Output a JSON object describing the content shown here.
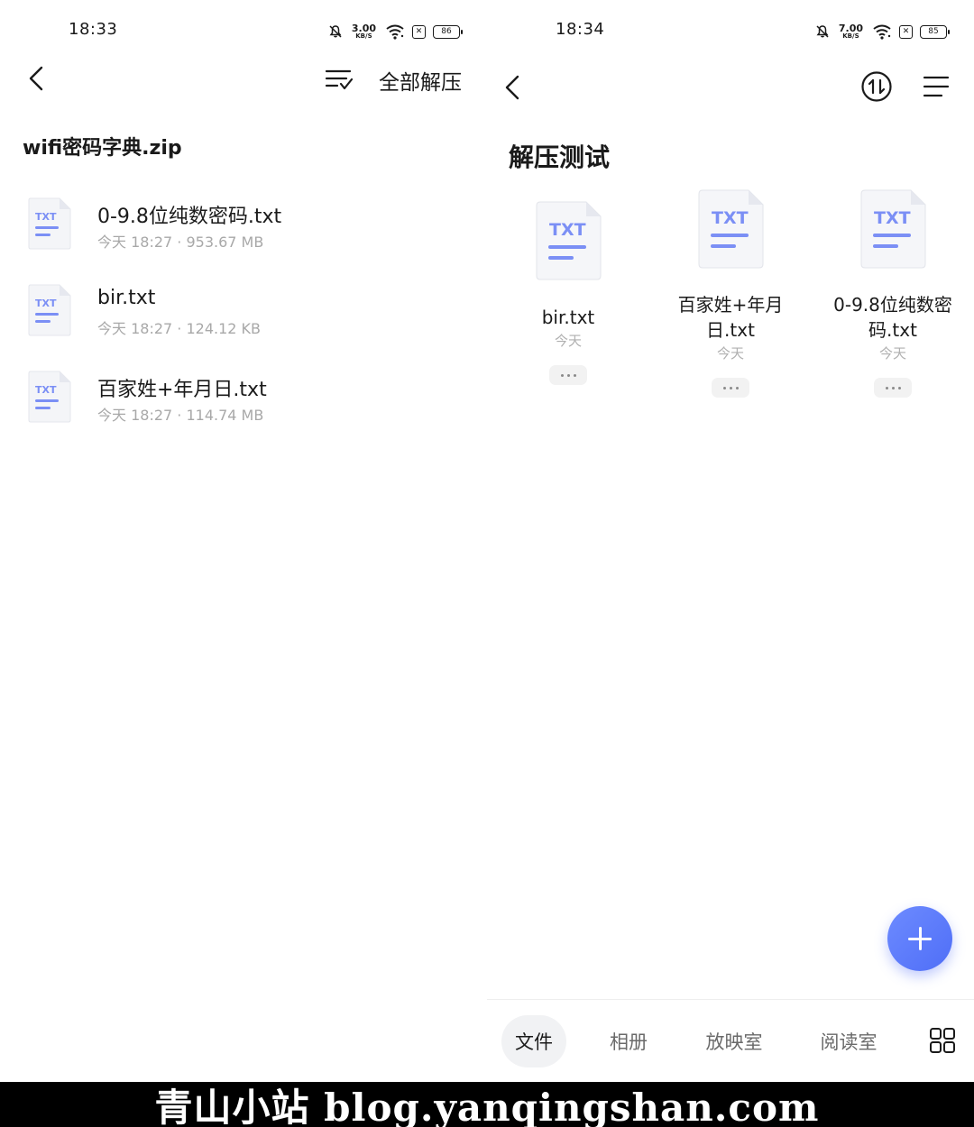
{
  "left": {
    "status": {
      "time": "18:33",
      "speed_value": "3.00",
      "speed_unit": "KB/S",
      "battery": "86"
    },
    "header": {
      "extract_all": "全部解压"
    },
    "zip_title": "wifi密码字典.zip",
    "files": [
      {
        "name": "0-9.8位纯数密码.txt",
        "meta": "今天 18:27 · 953.67 MB",
        "icon_label": "TXT"
      },
      {
        "name": "bir.txt",
        "meta": "今天 18:27 · 124.12 KB",
        "icon_label": "TXT"
      },
      {
        "name": "百家姓+年月日.txt",
        "meta": "今天 18:27 · 114.74 MB",
        "icon_label": "TXT"
      }
    ]
  },
  "right": {
    "status": {
      "time": "18:34",
      "speed_value": "7.00",
      "speed_unit": "KB/S",
      "battery": "85"
    },
    "folder_title": "解压测试",
    "items": [
      {
        "name_lines": [
          "bir.txt"
        ],
        "date": "今天",
        "icon_label": "TXT"
      },
      {
        "name_lines": [
          "百家姓+年月",
          "日.txt"
        ],
        "date": "今天",
        "icon_label": "TXT"
      },
      {
        "name_lines": [
          "0-9.8位纯数密",
          "码.txt"
        ],
        "date": "今天",
        "icon_label": "TXT"
      }
    ],
    "nav": [
      {
        "label": "文件",
        "active": true
      },
      {
        "label": "相册",
        "active": false
      },
      {
        "label": "放映室",
        "active": false
      },
      {
        "label": "阅读室",
        "active": false
      }
    ]
  },
  "colors": {
    "accent": "#4f6ef7",
    "icon_bar": "#7b8ff5",
    "muted": "#a8a8a8"
  },
  "icons": [
    "back-icon",
    "sort-check-icon",
    "transfer-icon",
    "menu-icon",
    "plus-icon",
    "apps-grid-icon",
    "txt-file-icon",
    "mute-bell-icon",
    "wifi-icon",
    "battery-icon"
  ],
  "watermark": "青山小站 blog.yanqingshan.com"
}
